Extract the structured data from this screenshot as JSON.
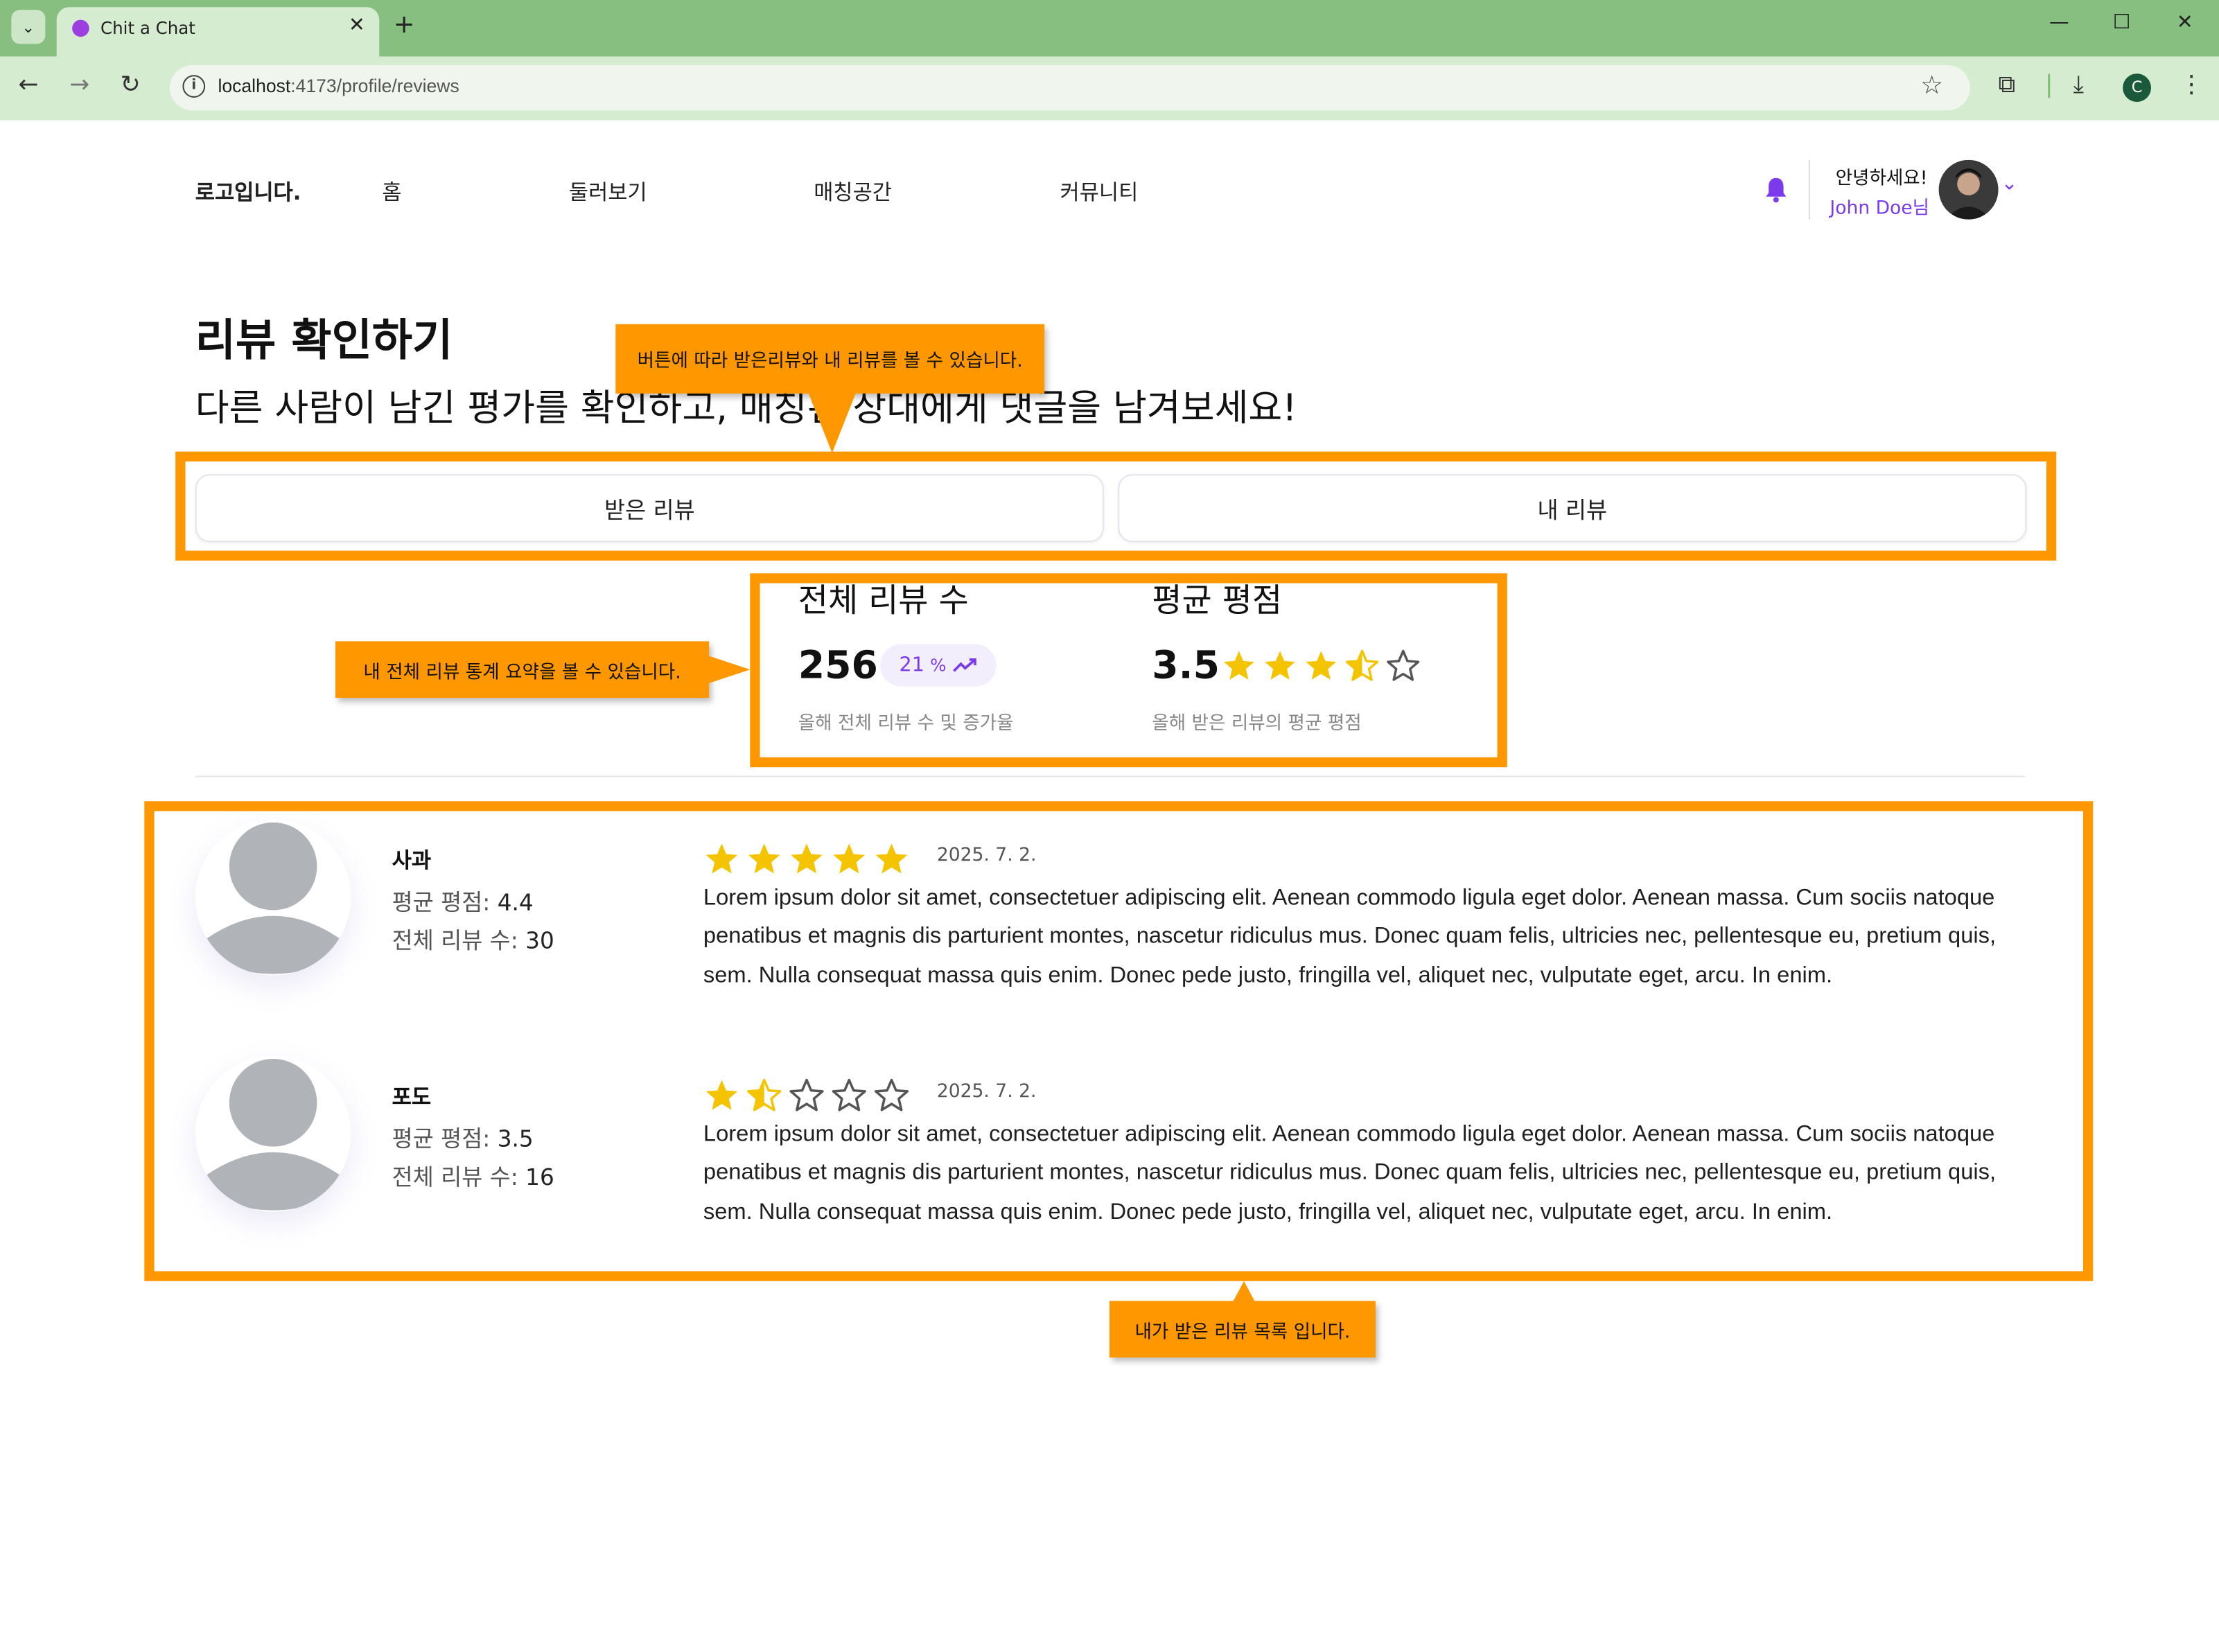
{
  "browser": {
    "tab_title": "Chit a Chat",
    "url_host": "localhost",
    "url_path": ":4173/profile/reviews",
    "profile_initial": "C"
  },
  "header": {
    "logo": "로고입니다.",
    "nav": [
      "홈",
      "둘러보기",
      "매칭공간",
      "커뮤니티"
    ],
    "greeting": "안녕하세요!",
    "user_name": "John Doe님",
    "accent_color": "#7c3aed"
  },
  "main": {
    "title": "리뷰 확인하기",
    "subtitle": "다른 사람이 남긴 평가를 확인하고, 매칭된 상대에게 댓글을 남겨보세요!",
    "tabs": [
      "받은 리뷰",
      "내 리뷰"
    ]
  },
  "stats": {
    "total_title": "전체 리뷰 수",
    "total_value": "256",
    "growth_value": "21",
    "growth_unit": "%",
    "total_sub": "올해 전체 리뷰 수 및 증가율",
    "avg_title": "평균 평점",
    "avg_value": "3.5",
    "avg_rating": 3.5,
    "avg_sub": "올해 받은 리뷰의 평균 평점"
  },
  "reviews": [
    {
      "name": "사과",
      "avg_label": "평균 평점:",
      "avg": "4.4",
      "count_label": "전체 리뷰 수:",
      "count": "30",
      "rating": 5,
      "date": "2025. 7. 2.",
      "text": "Lorem ipsum dolor sit amet, consectetuer adipiscing elit. Aenean commodo ligula eget dolor. Aenean massa. Cum sociis natoque penatibus et magnis dis parturient montes, nascetur ridiculus mus. Donec quam felis, ultricies nec, pellentesque eu, pretium quis, sem. Nulla consequat massa quis enim. Donec pede justo, fringilla vel, aliquet nec, vulputate eget, arcu. In enim."
    },
    {
      "name": "포도",
      "avg_label": "평균 평점:",
      "avg": "3.5",
      "count_label": "전체 리뷰 수:",
      "count": "16",
      "rating": 1.5,
      "date": "2025. 7. 2.",
      "text": "Lorem ipsum dolor sit amet, consectetuer adipiscing elit. Aenean commodo ligula eget dolor. Aenean massa. Cum sociis natoque penatibus et magnis dis parturient montes, nascetur ridiculus mus. Donec quam felis, ultricies nec, pellentesque eu, pretium quis, sem. Nulla consequat massa quis enim. Donec pede justo, fringilla vel, aliquet nec, vulputate eget, arcu. In enim."
    }
  ],
  "annotations": {
    "tabs_note": "버튼에 따라 받은리뷰와 내 리뷰를 볼 수 있습니다.",
    "stats_note": "내 전체 리뷰 통계 요약을 볼 수 있습니다.",
    "list_note": "내가 받은 리뷰 목록 입니다.",
    "highlight_color": "#ff9800"
  },
  "colors": {
    "star": "#f5c400",
    "star_empty": "#555555"
  }
}
